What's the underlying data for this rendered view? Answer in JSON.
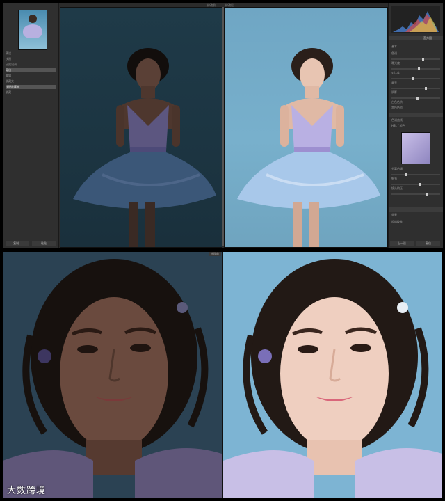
{
  "left_panel": {
    "rows": [
      "预设",
      "快照",
      "历史记录",
      "导出",
      "编辑",
      "收藏夹",
      "快捷收藏夹",
      "收藏"
    ],
    "copy_button": "复制...",
    "paste_button": "粘贴"
  },
  "filmstrip": {
    "before_label": "修改前",
    "after_label": "修改后"
  },
  "right_panel": {
    "title": "直方图",
    "rows": [
      "基本",
      "色调",
      "曝光度",
      "对比度",
      "高光",
      "阴影",
      "白色色阶",
      "黑色色阶",
      "清晰度",
      "鲜艳度",
      "饱和度",
      "色调曲线",
      "HSL / 颜色",
      "分离色调",
      "细节",
      "镜头校正",
      "效果",
      "相机校准"
    ],
    "prev_button": "上一张",
    "reset_button": "复位"
  },
  "compare": {
    "before_tag": "修改前",
    "after_tag": "修改后"
  },
  "watermark": "大数跨境",
  "colors": {
    "before_bg": "#2b4253",
    "after_bg": "#7db4d3",
    "dress": "#b9b0e3"
  }
}
